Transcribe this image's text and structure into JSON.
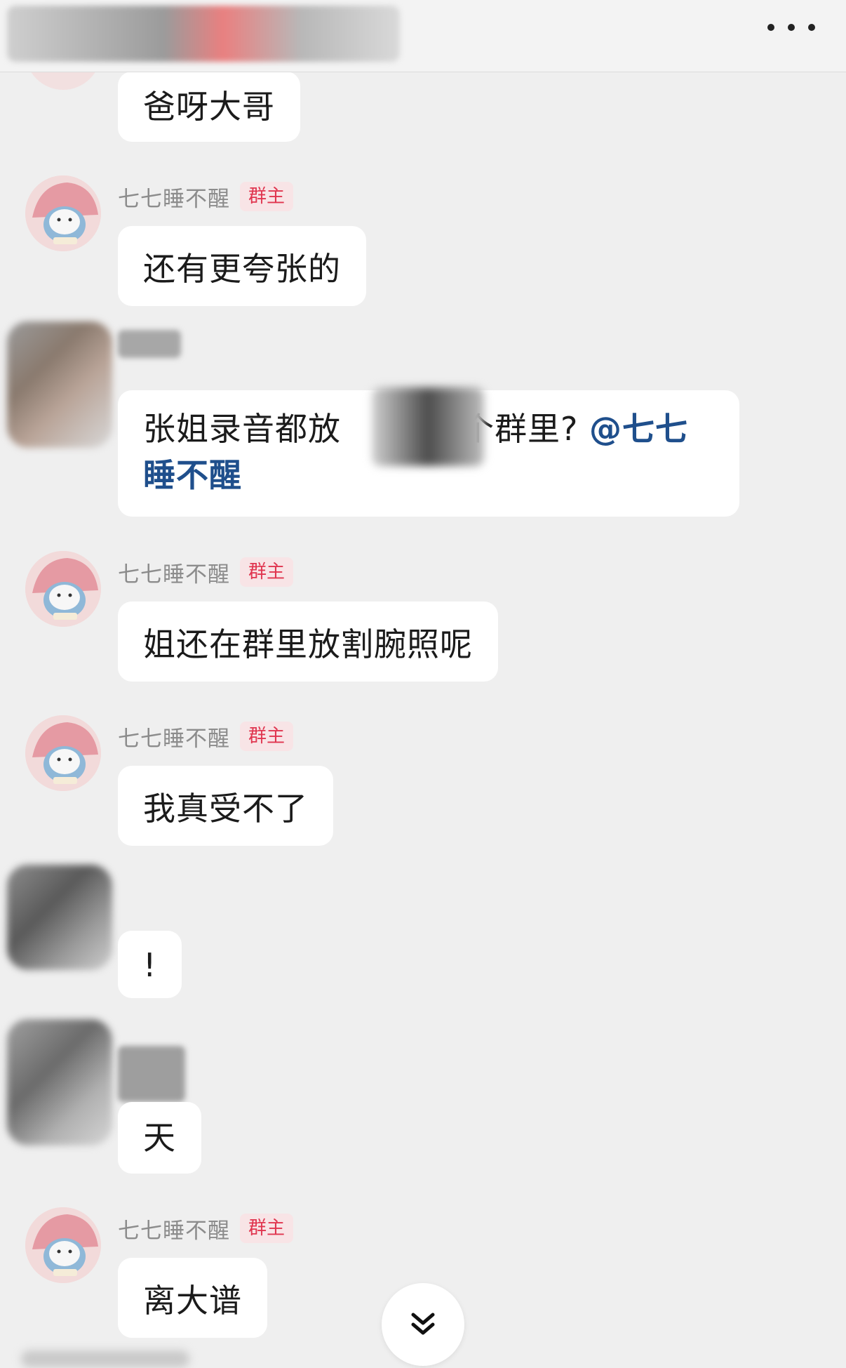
{
  "header": {
    "more_icon": "more-dots-icon"
  },
  "owner_badge": "群主",
  "messages": [
    {
      "sender": "",
      "text": "爸呀大哥",
      "badge": false
    },
    {
      "sender": "七七睡不醒",
      "text": "还有更夸张的",
      "badge": true
    },
    {
      "sender": "",
      "text_before": "张姐录音都放",
      "text_after": "个群里?",
      "mention": "@七七睡不醒",
      "badge": false
    },
    {
      "sender": "七七睡不醒",
      "text": "姐还在群里放割腕照呢",
      "badge": true
    },
    {
      "sender": "七七睡不醒",
      "text": "我真受不了",
      "badge": true
    },
    {
      "sender": "",
      "text": "!",
      "badge": false
    },
    {
      "sender": "",
      "text": "天",
      "badge": false
    },
    {
      "sender": "七七睡不醒",
      "text": "离大谱",
      "badge": true
    }
  ],
  "scroll_icon": "double-chevron-down-icon",
  "colors": {
    "background": "#efefef",
    "bubble": "#ffffff",
    "badge_text": "#e0354f",
    "badge_bg": "#f8e4e6",
    "mention": "#1f4f8c"
  }
}
